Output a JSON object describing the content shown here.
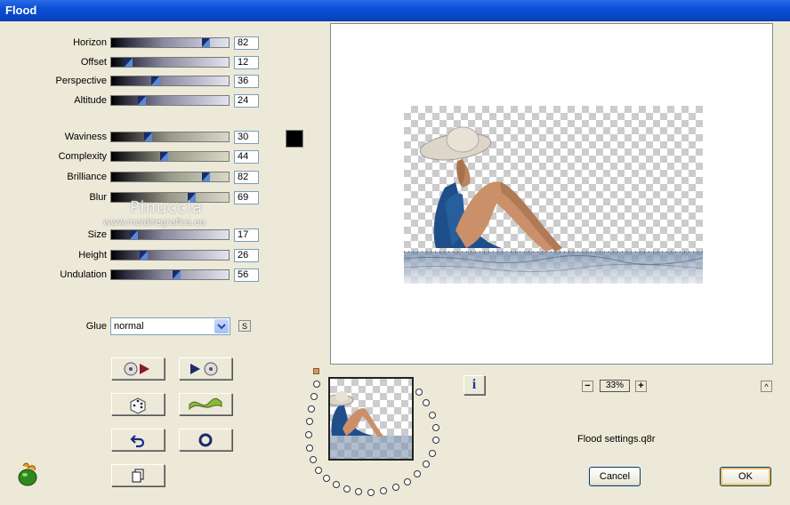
{
  "window": {
    "title": "Flood"
  },
  "sliders": [
    {
      "label": "Horizon",
      "value": "82",
      "pct": 0.82
    },
    {
      "label": "Offset",
      "value": "12",
      "pct": 0.12
    },
    {
      "label": "Perspective",
      "value": "36",
      "pct": 0.36
    },
    {
      "label": "Altitude",
      "value": "24",
      "pct": 0.24
    },
    {
      "label": "Waviness",
      "value": "30",
      "pct": 0.3
    },
    {
      "label": "Complexity",
      "value": "44",
      "pct": 0.44
    },
    {
      "label": "Brilliance",
      "value": "82",
      "pct": 0.82
    },
    {
      "label": "Blur",
      "value": "69",
      "pct": 0.69
    },
    {
      "label": "Size",
      "value": "17",
      "pct": 0.17
    },
    {
      "label": "Height",
      "value": "26",
      "pct": 0.26
    },
    {
      "label": "Undulation",
      "value": "56",
      "pct": 0.56
    }
  ],
  "watermark": {
    "name": "Pinuccia",
    "site": "www.maidiregrafica.eu"
  },
  "glue": {
    "label": "Glue",
    "value": "normal",
    "s_button": "S"
  },
  "color_swatch": "#000000",
  "zoom": {
    "value": "33%"
  },
  "settings_file": "Flood settings.q8r",
  "buttons": {
    "cancel": "Cancel",
    "ok": "OK",
    "info": "i",
    "minus": "−",
    "plus": "+",
    "up": "^"
  },
  "icons": [
    "open-preset-icon",
    "save-preset-icon",
    "random-dice-icon",
    "wave-icon",
    "undo-icon",
    "reset-circle-icon",
    "copy-icon",
    "flaming-pear-logo-icon"
  ]
}
